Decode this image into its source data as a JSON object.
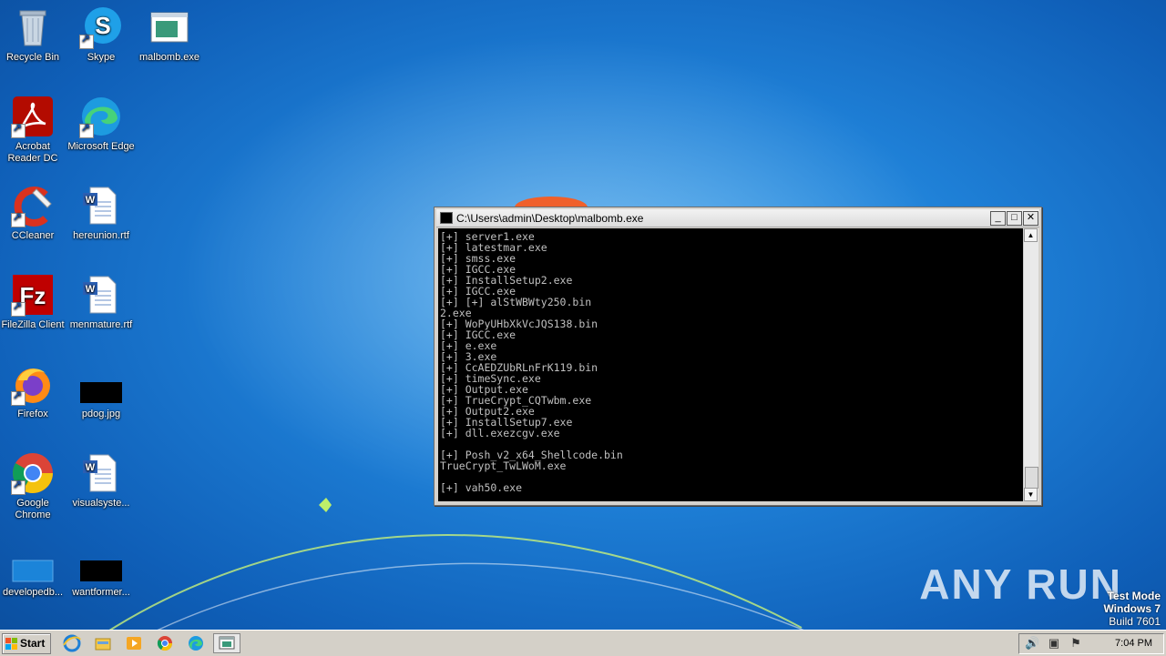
{
  "desktop": {
    "icons": [
      {
        "label": "Recycle Bin",
        "icon": "recycle-bin-icon"
      },
      {
        "label": "Skype",
        "icon": "skype-icon"
      },
      {
        "label": "malbomb.exe",
        "icon": "exe-window-icon"
      },
      {
        "label": "Acrobat Reader DC",
        "icon": "acrobat-icon"
      },
      {
        "label": "Microsoft Edge",
        "icon": "edge-icon"
      },
      {
        "label": "CCleaner",
        "icon": "ccleaner-icon"
      },
      {
        "label": "hereunion.rtf",
        "icon": "word-doc-icon"
      },
      {
        "label": "FileZilla Client",
        "icon": "filezilla-icon"
      },
      {
        "label": "menmature.rtf",
        "icon": "word-doc-icon"
      },
      {
        "label": "Firefox",
        "icon": "firefox-icon"
      },
      {
        "label": "pdog.jpg",
        "icon": "black-image-icon"
      },
      {
        "label": "Google Chrome",
        "icon": "chrome-icon"
      },
      {
        "label": "visualsyste...",
        "icon": "word-doc-icon"
      },
      {
        "label": "developedb...",
        "icon": "blue-image-icon"
      },
      {
        "label": "wantformer...",
        "icon": "black-image-icon"
      }
    ]
  },
  "console": {
    "title": "C:\\Users\\admin\\Desktop\\malbomb.exe",
    "minimize": "_",
    "maximize": "□",
    "close": "✕",
    "lines": [
      "[+] server1.exe",
      "[+] latestmar.exe",
      "[+] smss.exe",
      "[+] IGCC.exe",
      "[+] InstallSetup2.exe",
      "[+] IGCC.exe",
      "[+] [+] alStWBWty250.bin",
      "2.exe",
      "[+] WoPyUHbXkVcJQS138.bin",
      "[+] IGCC.exe",
      "[+] e.exe",
      "[+] 3.exe",
      "[+] CcAEDZUbRLnFrK119.bin",
      "[+] timeSync.exe",
      "[+] Output.exe",
      "[+] TrueCrypt_CQTwbm.exe",
      "[+] Output2.exe",
      "[+] InstallSetup7.exe",
      "[+] dll.exezcgv.exe",
      "",
      "[+] Posh_v2_x64_Shellcode.bin",
      "TrueCrypt_TwLWoM.exe",
      "",
      "[+] vah50.exe"
    ]
  },
  "watermark": {
    "text": "ANY RUN"
  },
  "test_mode": {
    "line1": "Test Mode",
    "line2": "Windows 7",
    "line3": "Build 7601"
  },
  "taskbar": {
    "start_label": "Start",
    "pinned": [
      "ie-icon",
      "explorer-icon",
      "media-player-icon",
      "chrome-icon",
      "edge-icon",
      "console-icon"
    ],
    "clock": "7:04 PM"
  }
}
